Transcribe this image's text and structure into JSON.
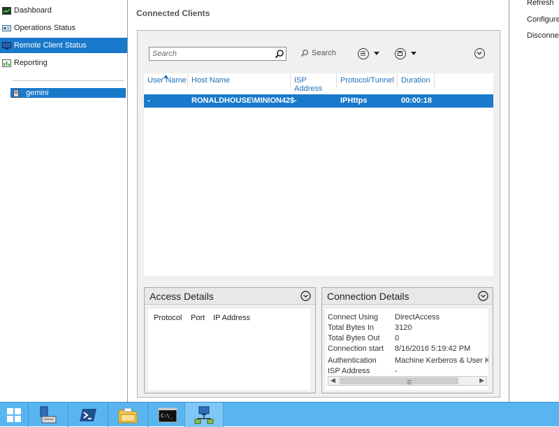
{
  "nav": {
    "items": [
      {
        "label": "Dashboard",
        "icon": "dashboard-icon"
      },
      {
        "label": "Operations Status",
        "icon": "operations-status-icon"
      },
      {
        "label": "Remote Client Status",
        "icon": "monitor-icon",
        "selected": true
      },
      {
        "label": "Reporting",
        "icon": "reporting-icon"
      }
    ],
    "server": {
      "label": "gemini",
      "icon": "server-icon"
    }
  },
  "main": {
    "title": "Connected Clients",
    "toolbar": {
      "search_placeholder": "Search",
      "search_button_label": "Search"
    },
    "columns": [
      "User Name",
      "Host Name",
      "ISP Address",
      "Protocol/Tunnel",
      "Duration"
    ],
    "rows": [
      {
        "user_name": "-",
        "host_name": "RONALDHOUSE\\MINION42$",
        "isp_address": "-",
        "protocol": "IPHttps",
        "duration": "00:00:18"
      }
    ],
    "access_details": {
      "title": "Access Details",
      "columns": [
        "Protocol",
        "Port",
        "IP Address"
      ]
    },
    "connection_details": {
      "title": "Connection Details",
      "fields": [
        {
          "key": "Connect Using",
          "value": "DirectAccess"
        },
        {
          "key": "Total Bytes In",
          "value": "3120"
        },
        {
          "key": "Total Bytes Out",
          "value": "0"
        },
        {
          "key": "Connection start",
          "value": "8/16/2016 5:19:42 PM"
        },
        {
          "key": "Authentication",
          "value": "Machine Kerberos & User Ke"
        },
        {
          "key": "ISP Address",
          "value": "-"
        }
      ]
    }
  },
  "actions": {
    "items": [
      "Refresh",
      "Configure",
      "Disconnect"
    ]
  },
  "taskbar": {
    "items": [
      "start-icon",
      "server-manager-icon",
      "powershell-icon",
      "file-explorer-icon",
      "command-prompt-icon",
      "remote-access-icon"
    ]
  },
  "colors": {
    "selection": "#1979ca",
    "header_link": "#1f6fb8",
    "taskbar": "#59b5f0"
  }
}
